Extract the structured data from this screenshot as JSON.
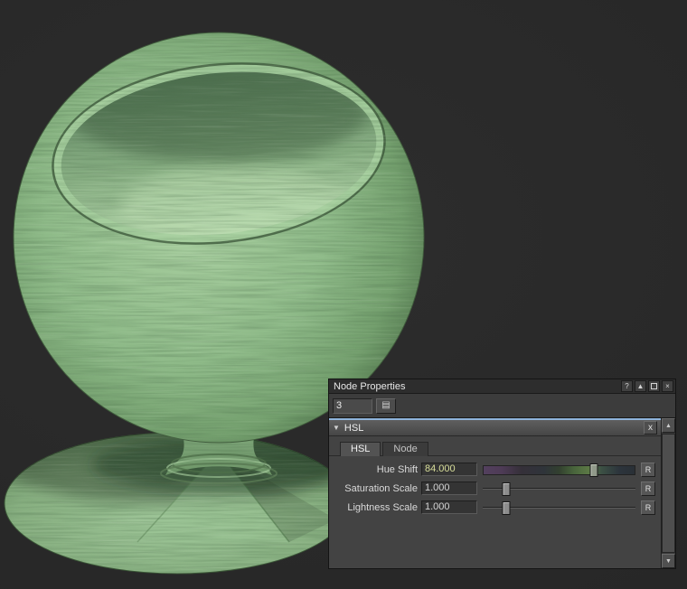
{
  "viewport": {
    "background_color": "#2a2a2a",
    "material_preview": {
      "description": "green wood textured shader ball",
      "base_color": "#8cba86"
    }
  },
  "panel": {
    "title": "Node Properties",
    "titlebar_icons": [
      {
        "name": "help-icon",
        "glyph": "?"
      },
      {
        "name": "collapse-icon",
        "glyph": "▲"
      },
      {
        "name": "float-window-icon",
        "glyph": ""
      },
      {
        "name": "close-icon",
        "glyph": "×"
      }
    ],
    "index_field": {
      "value": "3"
    },
    "list_button": {
      "glyph": "▤"
    },
    "section": {
      "header": "HSL",
      "expand_icon": "▼",
      "close_label": "x",
      "tabs": [
        {
          "label": "HSL"
        },
        {
          "label": "Node"
        }
      ],
      "controls": [
        {
          "label": "Hue Shift",
          "value": "84.000",
          "reset": "R",
          "handle_pct": 72
        },
        {
          "label": "Saturation Scale",
          "value": "1.000",
          "reset": "R",
          "handle_pct": 16
        },
        {
          "label": "Lightness Scale",
          "value": "1.000",
          "reset": "R",
          "handle_pct": 16
        }
      ]
    },
    "scrollbar": {
      "up": "▲",
      "down": "▼"
    }
  },
  "colors": {
    "accent_blue": "#8fb4dc",
    "hue_value_text": "#d8de9a",
    "material_green": "#8cba86"
  }
}
